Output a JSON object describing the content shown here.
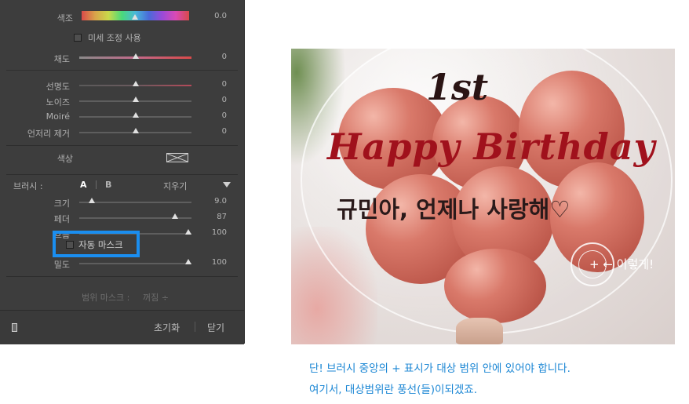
{
  "panel": {
    "hue": {
      "label": "색조",
      "value": "0.0"
    },
    "fine_adjust": {
      "label": "미세 조정 사용"
    },
    "saturation": {
      "label": "채도",
      "value": "0"
    },
    "sharpness": {
      "label": "선명도",
      "value": "0"
    },
    "noise": {
      "label": "노이즈",
      "value": "0"
    },
    "moire": {
      "label": "Moiré",
      "value": "0"
    },
    "defringe": {
      "label": "언저리 제거",
      "value": "0"
    },
    "color": {
      "label": "색상"
    },
    "brush": {
      "label": "브러시 :",
      "a": "A",
      "b": "B",
      "erase": "지우기",
      "toggle_icon": "triangle-down-icon"
    },
    "size": {
      "label": "크기",
      "value": "9.0"
    },
    "feather": {
      "label": "페더",
      "value": "87"
    },
    "flow": {
      "label": "흐름",
      "value": "100"
    },
    "auto_mask": {
      "label": "자동 마스크"
    },
    "density": {
      "label": "밀도",
      "value": "100"
    },
    "range_mask": {
      "label": "범위 마스크 :",
      "value": "꺼짐 ÷"
    },
    "reset": "초기화",
    "close": "닫기",
    "highlight_color": "#1a8ef0"
  },
  "photo": {
    "title_line1": "1st",
    "title_line2": "Happy Birthday",
    "message": "규민아, 언제나 사랑해♡",
    "cursor_label": "+ ← 이렇게!"
  },
  "caption": {
    "line1": "단! 브러시 중앙의 + 표시가 대상 범위 안에 있어야 합니다.",
    "line2": "여기서, 대상범위란 풍선(들)이되겠죠.",
    "color": "#1a86d4"
  }
}
